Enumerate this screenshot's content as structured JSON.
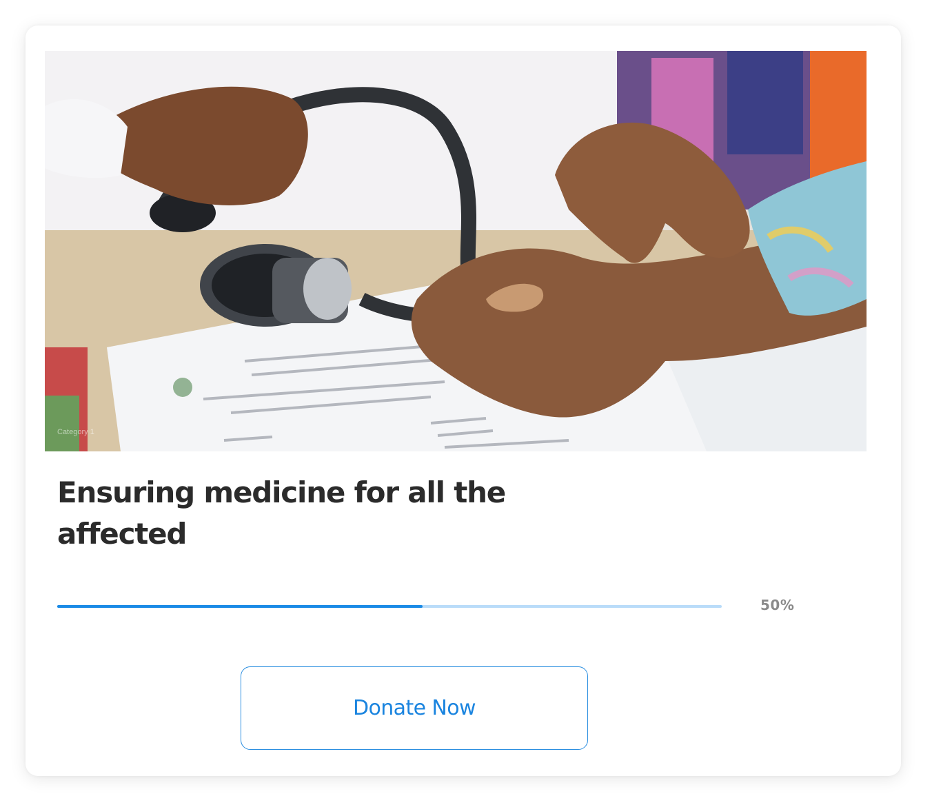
{
  "campaign": {
    "image": {
      "alt": "",
      "category_label": "Category 1"
    },
    "title": "Ensuring medicine for all the affected",
    "progress": {
      "percent": 50,
      "label": "50%"
    },
    "donate_button_label": "Donate Now"
  },
  "colors": {
    "accent": "#1a8ae6",
    "track": "#b9dcf9",
    "title": "#2b2b2b",
    "muted": "#8a8a8a"
  }
}
